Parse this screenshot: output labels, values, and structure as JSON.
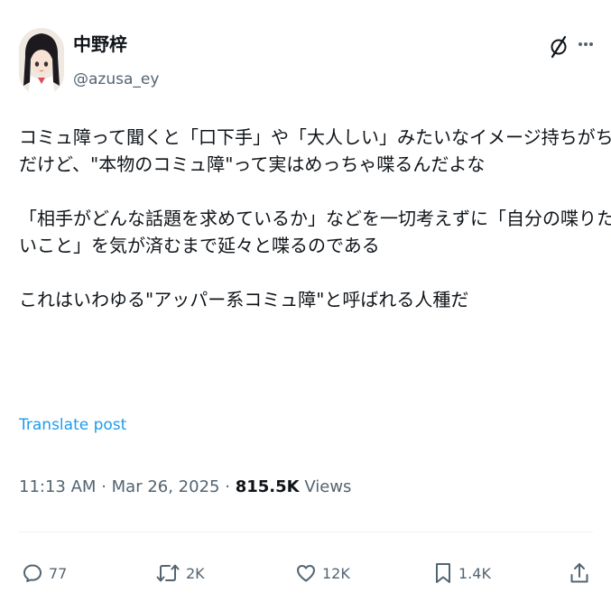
{
  "author": {
    "display_name": "中野梓",
    "handle": "@azusa_ey"
  },
  "post": {
    "lines": [
      "コミュ障って聞くと「口下手」や「大人しい」みたいなイメージ持ちがち",
      "だけど、\"本物のコミュ障\"って実はめっちゃ喋るんだよな",
      "",
      "「相手がどんな話題を求めているか」などを一切考えずに「自分の喋りた",
      "いこと」を気が済むまで延々と喋るのである",
      "",
      "これはいわゆる\"アッパー系コミュ障\"と呼ばれる人種だ"
    ],
    "translate_label": "Translate post",
    "time": "11:13 AM",
    "separator": "·",
    "date": "Mar 26, 2025",
    "views_count": "815.5K",
    "views_label": "Views"
  },
  "actions": {
    "replies": "77",
    "reposts": "2K",
    "likes": "12K",
    "bookmarks": "1.4K"
  },
  "icons": {
    "top_right": [
      "grok-icon",
      "more-icon"
    ],
    "action_bar": [
      "reply-icon",
      "repost-icon",
      "like-icon",
      "bookmark-icon",
      "share-icon"
    ]
  },
  "colors": {
    "text": "#0f1419",
    "secondary": "#536471",
    "link": "#1d9bf0",
    "divider": "#eff3f4"
  }
}
